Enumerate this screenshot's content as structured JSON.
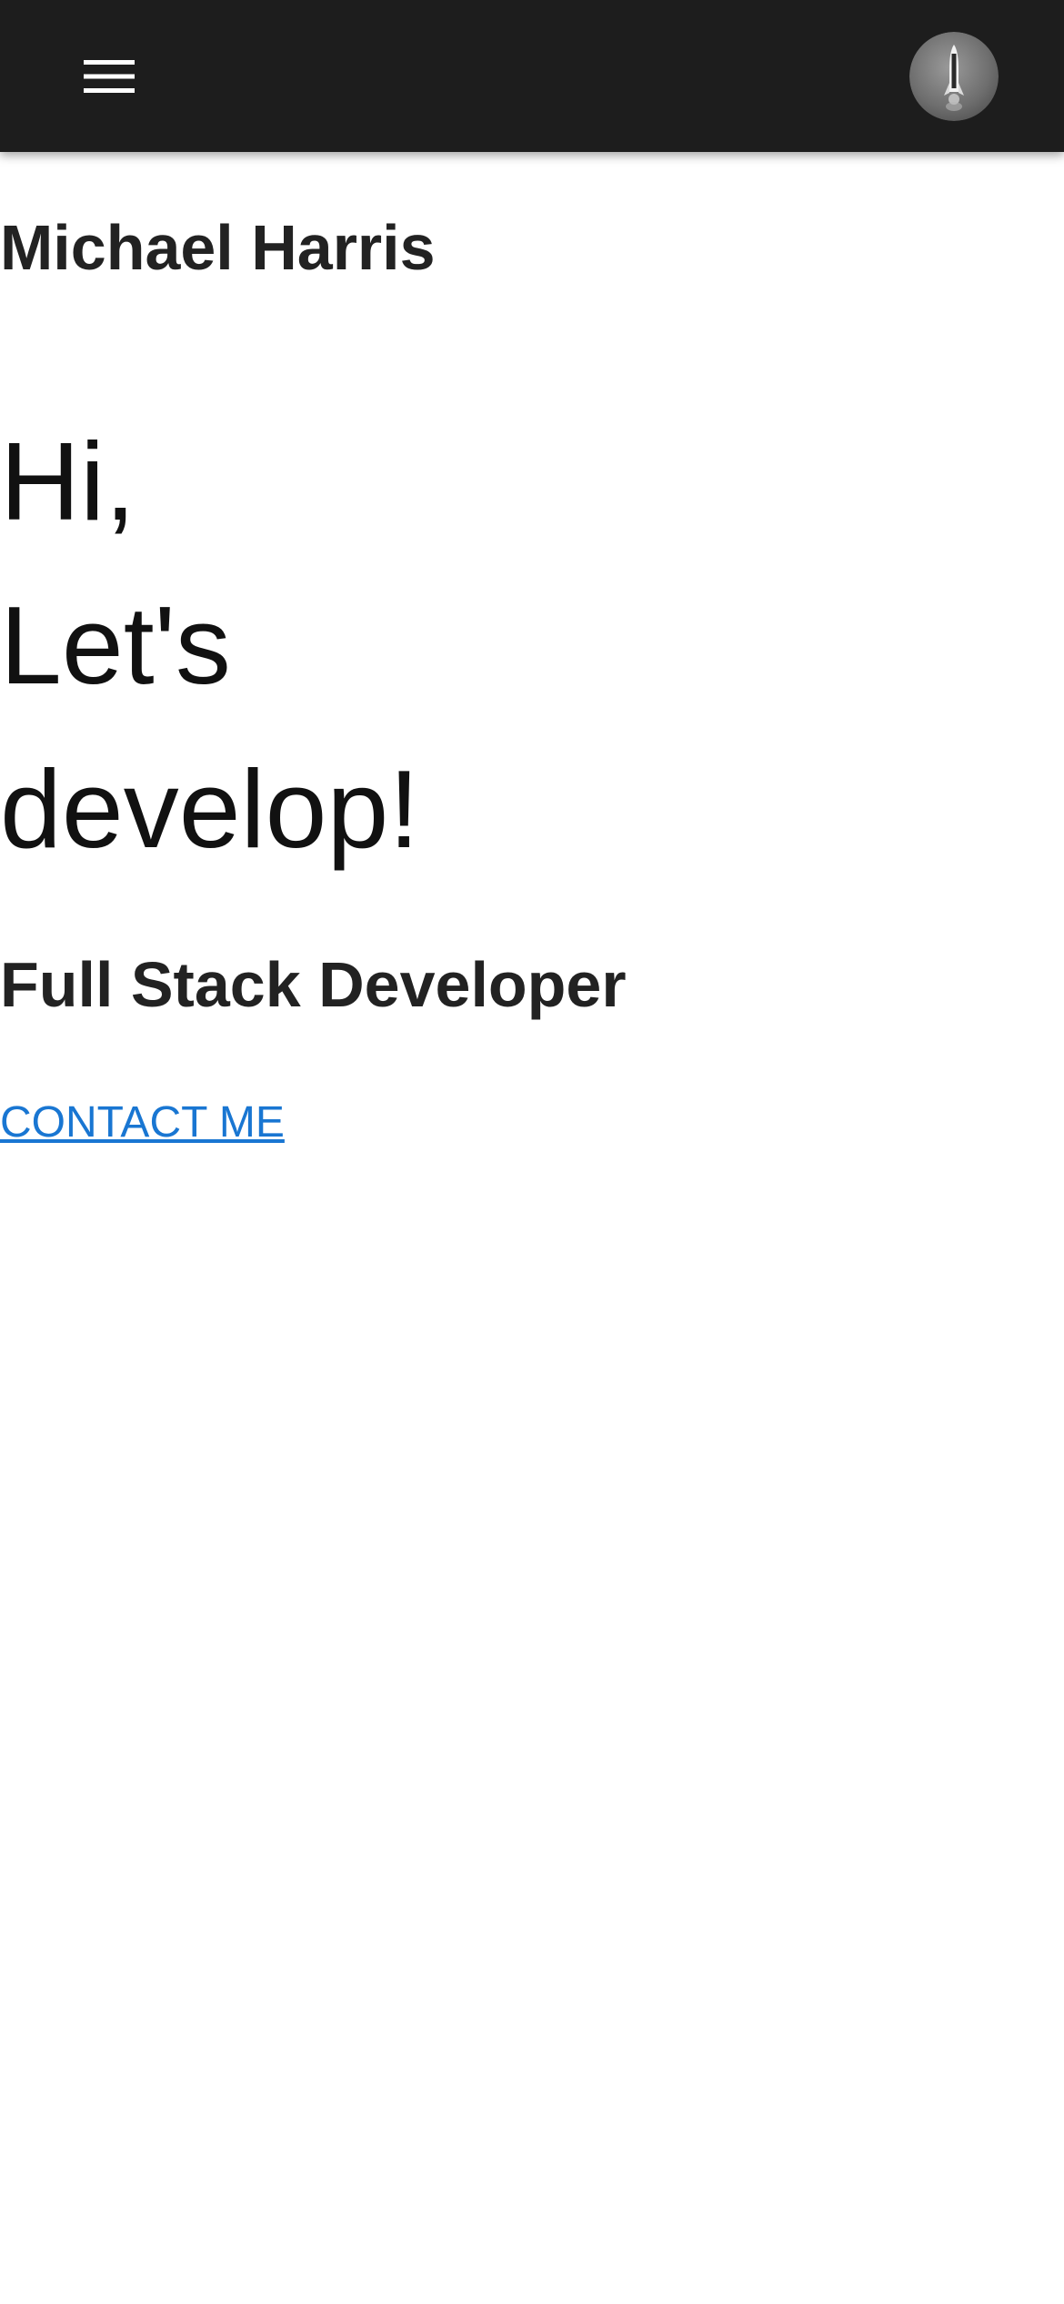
{
  "header": {
    "menu_icon": "hamburger-menu-icon",
    "avatar_icon": "rocket-avatar"
  },
  "hero": {
    "site_name": "Michael Harris",
    "greeting_lines": [
      "Hi,",
      "Let's",
      "develop!"
    ],
    "role": "Full Stack Developer",
    "contact_label": "CONTACT ME"
  },
  "colors": {
    "app_bar": "#1d1d1d",
    "link": "#1976d2",
    "text": "#222222"
  }
}
